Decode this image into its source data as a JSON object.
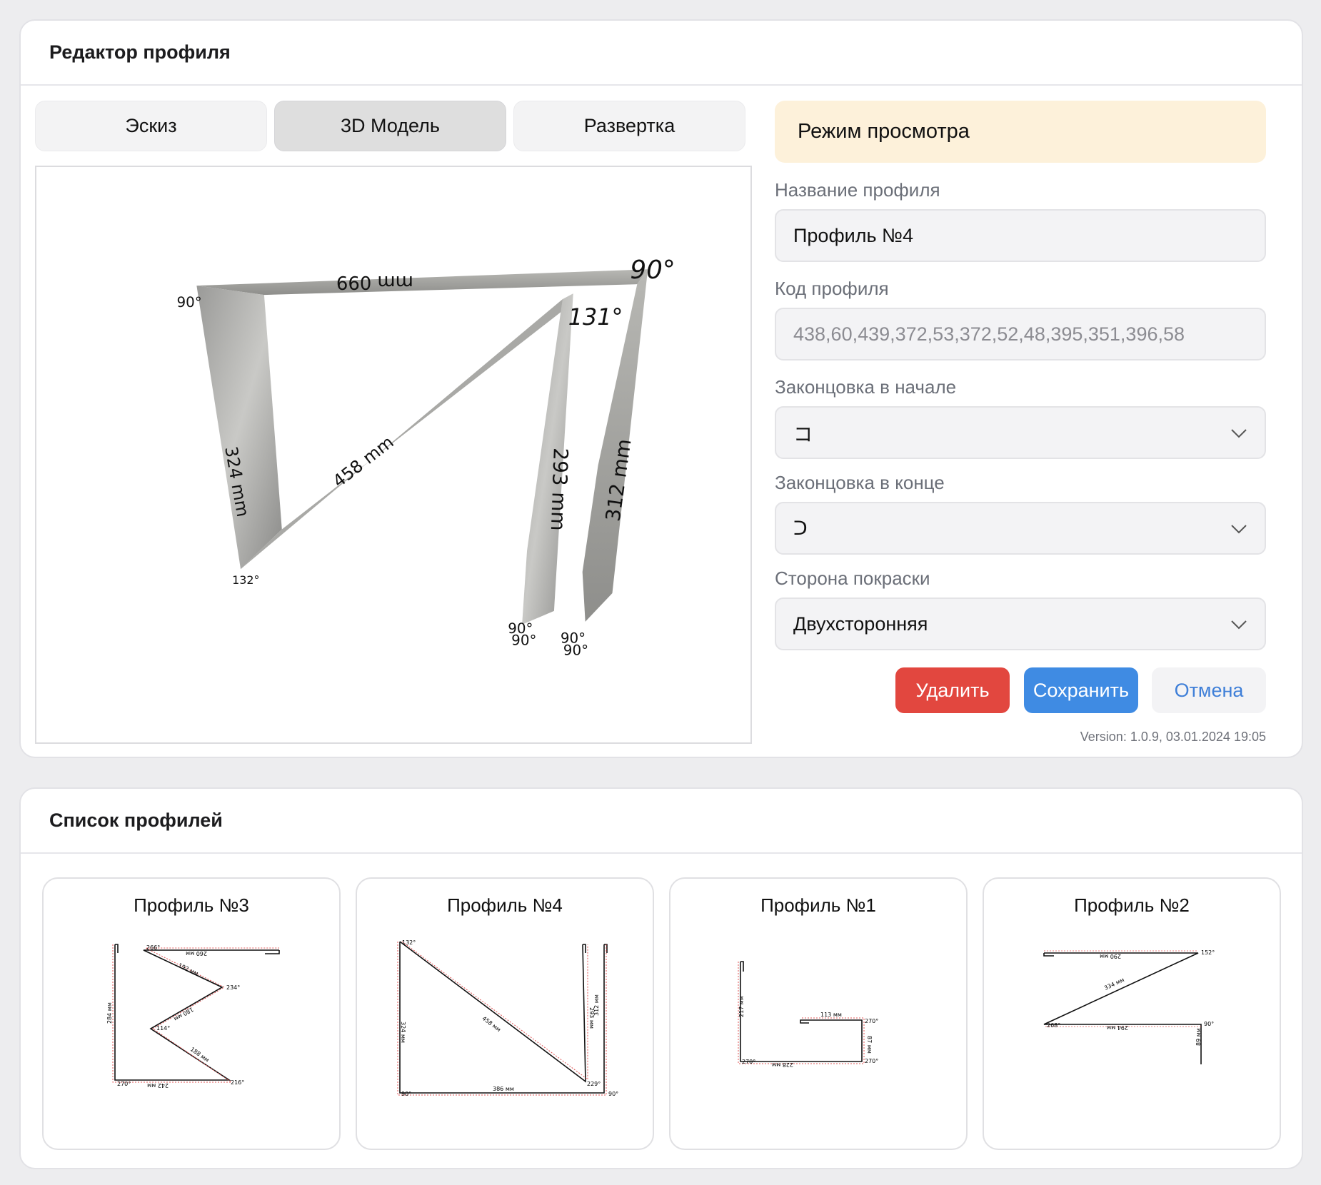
{
  "editor": {
    "title": "Редактор профиля",
    "tabs": [
      {
        "label": "Эскиз",
        "active": false
      },
      {
        "label": "3D Модель",
        "active": true
      },
      {
        "label": "Развертка",
        "active": false
      }
    ],
    "viewer_labels": {
      "top_len": "mm 099",
      "left_len": "324 mm",
      "diag_len": "458 mm",
      "mid_len": "293 mm",
      "right_len": "312 mm",
      "angle_tl": "90°",
      "angle_tr": "90°",
      "angle_inner": "131°",
      "angle_bl": "132°",
      "angle_b1a": "90°",
      "angle_b1b": "90°",
      "angle_b2a": "90°",
      "angle_b2b": "90°"
    },
    "mode_banner": "Режим просмотра",
    "fields": {
      "name_label": "Название профиля",
      "name_value": "Профиль №4",
      "code_label": "Код профиля",
      "code_value": "438,60,439,372,53,372,52,48,395,351,396,58",
      "start_label": "Законцовка в начале",
      "start_value": "コ",
      "end_label": "Законцовка в конце",
      "end_value": "ᑐ",
      "paint_label": "Сторона покраски",
      "paint_value": "Двухсторонняя"
    },
    "buttons": {
      "delete": "Удалить",
      "save": "Сохранить",
      "cancel": "Отмена"
    },
    "version": "Version: 1.0.9, 03.01.2024 19:05"
  },
  "list": {
    "title": "Список профилей",
    "profiles": [
      {
        "name": "Профиль №3",
        "labels": [
          "260 мм",
          "192 мм",
          "234°",
          "180 мм",
          "114°",
          "188 мм",
          "216°",
          "242 мм",
          "270°",
          "284 мм",
          "266°"
        ]
      },
      {
        "name": "Профиль №4",
        "labels": [
          "132°",
          "324 мм",
          "458 мм",
          "293 мм",
          "312 мм",
          "229°",
          "386 мм",
          "90°",
          "90°"
        ]
      },
      {
        "name": "Профиль №1",
        "labels": [
          "217 мм",
          "113 мм",
          "270°",
          "87 мм",
          "270°",
          "228 мм",
          "270°"
        ]
      },
      {
        "name": "Профиль №2",
        "labels": [
          "290 мм",
          "152°",
          "334 мм",
          "268°",
          "294 мм",
          "90°",
          "89 мм"
        ]
      }
    ]
  }
}
